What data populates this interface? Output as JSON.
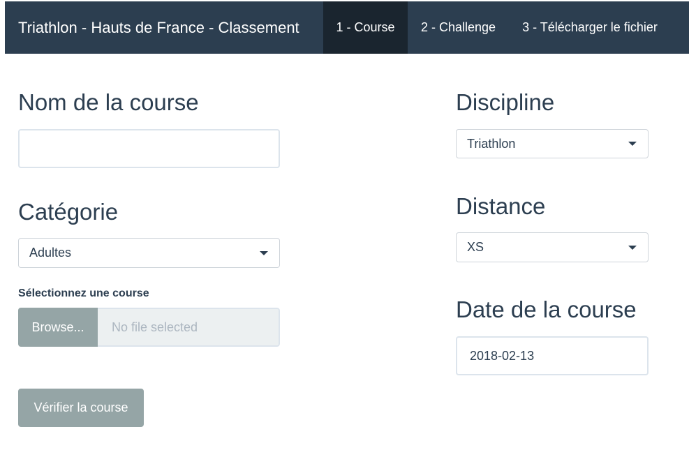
{
  "navbar": {
    "brand": "Triathlon - Hauts de France - Classement",
    "tabs": [
      {
        "label": "1 - Course",
        "active": true
      },
      {
        "label": "2 - Challenge",
        "active": false
      },
      {
        "label": "3 - Télécharger le fichier",
        "active": false
      }
    ]
  },
  "form": {
    "course_name": {
      "label": "Nom de la course",
      "value": ""
    },
    "category": {
      "label": "Catégorie",
      "selected": "Adultes"
    },
    "file_upload": {
      "label": "Sélectionnez une course",
      "browse_label": "Browse...",
      "placeholder": "No file selected"
    },
    "verify_button": "Vérifier la course",
    "discipline": {
      "label": "Discipline",
      "selected": "Triathlon"
    },
    "distance": {
      "label": "Distance",
      "selected": "XS"
    },
    "date": {
      "label": "Date de la course",
      "value": "2018-02-13"
    }
  },
  "colors": {
    "navbar_bg": "#2c3e50",
    "nav_active_bg": "#1a252f",
    "button_bg": "#95a5a6",
    "text": "#2c3e50"
  }
}
